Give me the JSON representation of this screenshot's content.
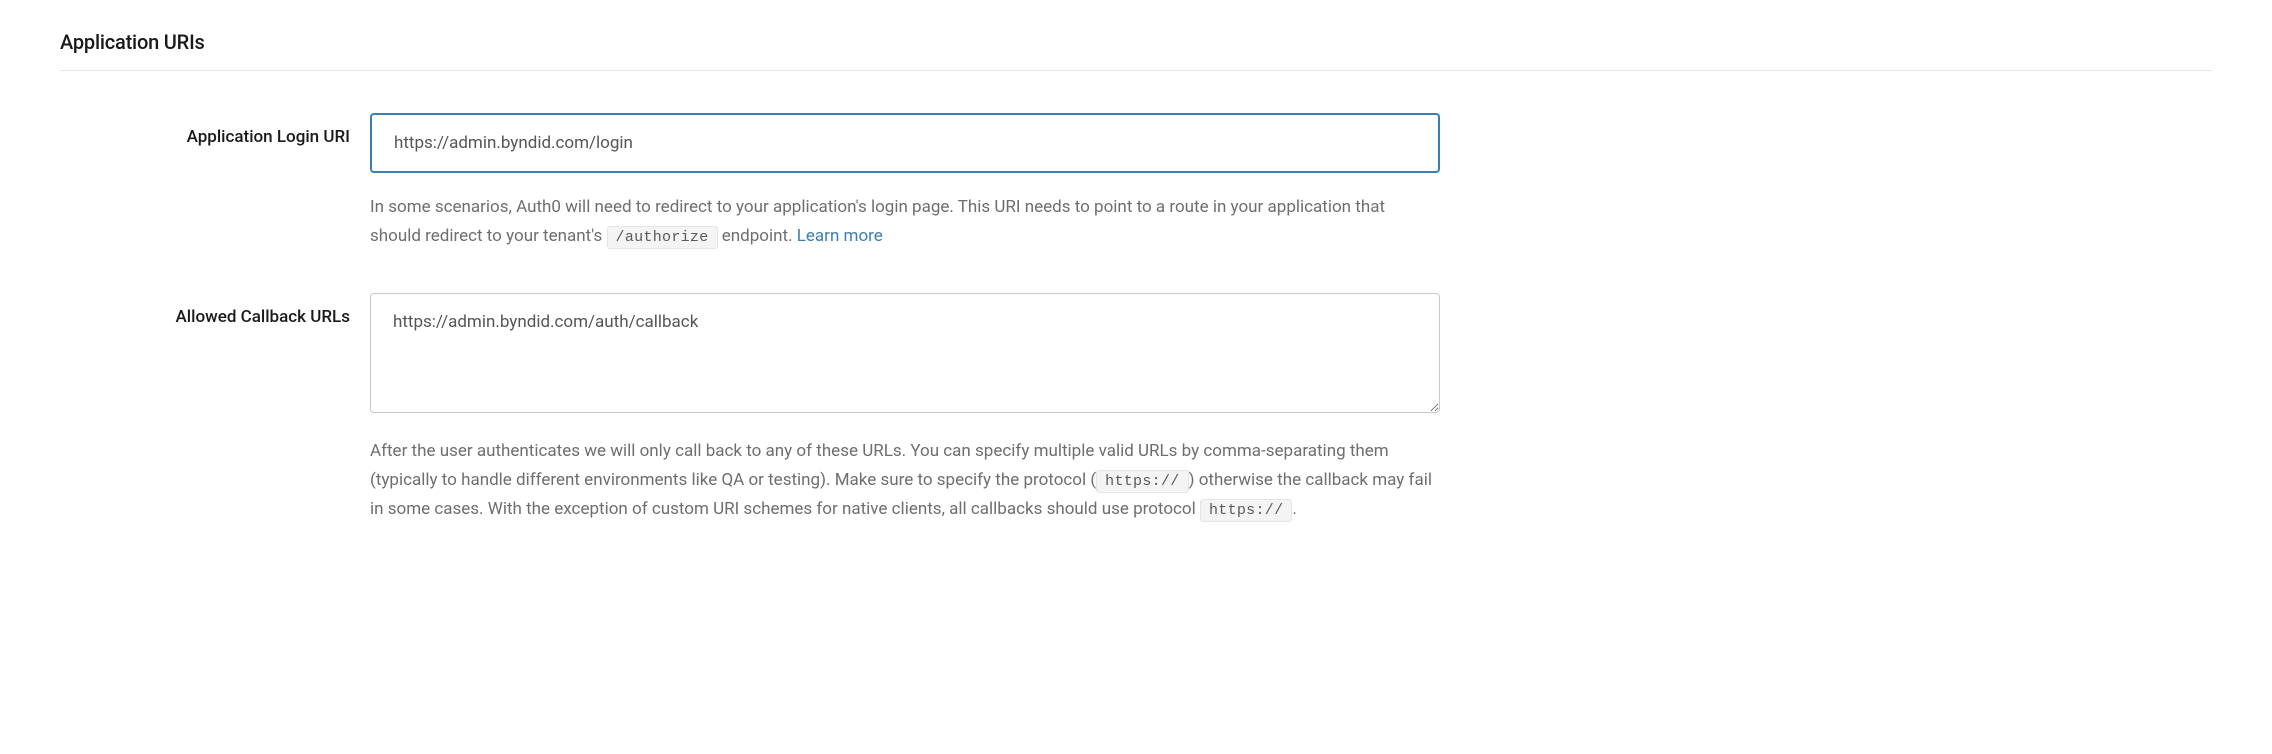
{
  "section": {
    "title": "Application URIs"
  },
  "loginUri": {
    "label": "Application Login URI",
    "value": "https://admin.byndid.com/login",
    "helpText1": "In some scenarios, Auth0 will need to redirect to your application's login page. This URI needs to point to a route in your application that should redirect to your tenant's ",
    "codeSnippet": "/authorize",
    "helpText2": " endpoint. ",
    "learnMore": "Learn more"
  },
  "callbackUrls": {
    "label": "Allowed Callback URLs",
    "value": "https://admin.byndid.com/auth/callback",
    "helpText1": "After the user authenticates we will only call back to any of these URLs. You can specify multiple valid URLs by comma-separating them (typically to handle different environments like QA or testing). Make sure to specify the protocol (",
    "codeSnippet1": "https://",
    "helpText2": ") otherwise the callback may fail in some cases. With the exception of custom URI schemes for native clients, all callbacks should use protocol ",
    "codeSnippet2": "https://",
    "helpText3": "."
  }
}
